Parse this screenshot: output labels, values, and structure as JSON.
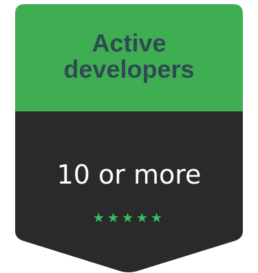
{
  "badge": {
    "title_line1": "Active",
    "title_line2": "developers",
    "value": "10 or more",
    "stars": "★★★★★",
    "star_count": 5,
    "colors": {
      "top": "#3fae52",
      "bottom": "#2a2a2a",
      "title_text": "#2f4a52",
      "value_text": "#ffffff",
      "stars": "#34c062"
    }
  }
}
